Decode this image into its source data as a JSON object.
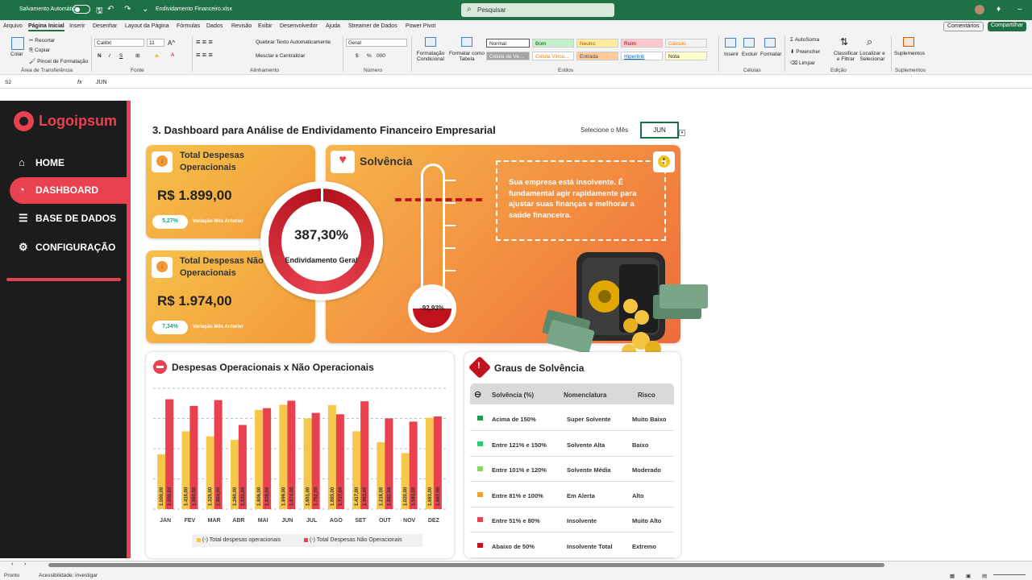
{
  "titlebar": {
    "autosave": "Salvamento Automático",
    "filename": "Endividamento Financeiro.xlsx",
    "search_placeholder": "Pesquisar"
  },
  "menu": [
    "Arquivo",
    "Página Inicial",
    "Inserir",
    "Desenhar",
    "Layout da Página",
    "Fórmulas",
    "Dados",
    "Revisão",
    "Exibir",
    "Desenvolvedor",
    "Ajuda",
    "Streamer de Dados",
    "Power Pivot"
  ],
  "menu_right": {
    "comments": "Comentários",
    "share": "Compartilhar"
  },
  "ribbon": {
    "clipboard": {
      "paste": "Colar",
      "cut": "Recortar",
      "copy": "Copiar",
      "painter": "Pincel de Formatação",
      "label": "Área de Transferência"
    },
    "font": {
      "name": "Calibri",
      "size": "11",
      "bold": "N",
      "italic": "I",
      "underline": "S",
      "label": "Fonte"
    },
    "alignment": {
      "wrap": "Quebrar Texto Automaticamente",
      "merge": "Mesclar e Centralizar",
      "label": "Alinhamento"
    },
    "number": {
      "format": "Geral",
      "percent": "%",
      "thousands": "000",
      "label": "Número"
    },
    "styles": {
      "cond": "Formatação Condicional",
      "table": "Formatar como Tabela",
      "items": [
        "Normal",
        "Bom",
        "Neutro",
        "Ruim",
        "Cálculo",
        "Célula de Ve...",
        "Célula Vincu...",
        "Entrada",
        "Hiperlink",
        "Nota"
      ],
      "label": "Estilos"
    },
    "cells": {
      "insert": "Inserir",
      "delete": "Excluir",
      "format": "Formatar",
      "label": "Células"
    },
    "editing": {
      "autosum": "AutoSoma",
      "fill": "Preencher",
      "clear": "Limpar",
      "sort": "Classificar e Filtrar",
      "find": "Localizar e Selecionar",
      "label": "Edição"
    },
    "addins": {
      "addins": "Suplementos",
      "label": "Suplementos"
    }
  },
  "formula": {
    "cell": "S2",
    "fx": "fx",
    "value": "JUN"
  },
  "sidebar": {
    "logo": "Logoipsum",
    "items": [
      "HOME",
      "DASHBOARD",
      "BASE DE DADOS",
      "CONFIGURAÇÃO"
    ]
  },
  "dashboard": {
    "title": "3. Dashboard para Análise de Endividamento Financeiro Empresarial",
    "select_label": "Selecione o Mês",
    "month": "JUN",
    "op": {
      "title": "Total Despesas Operacionais",
      "value": "R$ 1.899,00",
      "var": "5,27%",
      "var_label": "Variação Mês Anterior"
    },
    "nop": {
      "title": "Total Despesas Não Operacionais",
      "value": "R$ 1.974,00",
      "var": "7,34%",
      "var_label": "Variação Mês Anterior"
    },
    "debt": {
      "value": "387,30%",
      "label": "Endividamento Geral"
    },
    "solvency": {
      "title": "Solvência",
      "message": "Sua empresa está insolvente. É fundamental agir rapidamente para ajustar suas finanças e melhorar a saúde financeira.",
      "thermo": "-92,93%"
    },
    "chart_title": "Despesas Operacionais x Não Operacionais",
    "grades": {
      "title": "Graus de Solvência",
      "headers": [
        "Solvência (%)",
        "Nomenclatura",
        "Risco"
      ],
      "rows": [
        {
          "range": "Acima de 150%",
          "name": "Super Solvente",
          "risk": "Muito Baixo",
          "color": "#1e9e4a"
        },
        {
          "range": "Entre 121% e 150%",
          "name": "Solvente Alta",
          "risk": "Baixo",
          "color": "#2ecc71"
        },
        {
          "range": "Entre 101% e 120%",
          "name": "Solvente Média",
          "risk": "Moderado",
          "color": "#8bd65a"
        },
        {
          "range": "Entre 81% e 100%",
          "name": "Em Alerta",
          "risk": "Alto",
          "color": "#f0a030"
        },
        {
          "range": "Entre 51% e 80%",
          "name": "Insolvente",
          "risk": "Muito Alto",
          "color": "#e8414f"
        },
        {
          "range": "Abaixo  de 50%",
          "name": "Insolvente Total",
          "risk": "Extremo",
          "color": "#c0131d"
        }
      ]
    }
  },
  "chart_data": {
    "type": "bar",
    "categories": [
      "JAN",
      "FEV",
      "MAR",
      "ABR",
      "MAI",
      "JUN",
      "JUL",
      "AGO",
      "SET",
      "OUT",
      "NOV",
      "DEZ"
    ],
    "series": [
      {
        "name": "(-) Total despesas operacionais",
        "color": "#f5c74a",
        "values": [
          1000,
          1416,
          1325,
          1260,
          1806,
          1899,
          1651,
          1893,
          1417,
          1218,
          1020,
          1663
        ]
      },
      {
        "name": "(-) Total Despesas Não Operacionais",
        "color": "#e8414f",
        "values": [
          2000,
          1880,
          1984,
          1532,
          1839,
          1974,
          1752,
          1727,
          1963,
          1652,
          1593,
          1687
        ]
      }
    ],
    "data_labels": [
      [
        "1.000,00",
        "1.416,00",
        "1.325,00",
        "1.260,00",
        "1.806,00",
        "1.899,00",
        "1.651,00",
        "1.893,00",
        "1.417,00",
        "1.218,00",
        "1.020,00",
        "1.663,00"
      ],
      [
        "2.000,00",
        "1.880,00",
        "1.984,00",
        "1.532,00",
        "1.839,00",
        "1.974,00",
        "1.752,00",
        "1.727,00",
        "1.963,00",
        "1.652,00",
        "1.593,00",
        "1.687,00"
      ]
    ],
    "ylim": [
      0,
      2200
    ],
    "grid": true,
    "legend": "bottom"
  },
  "status": {
    "ready": "Pronto",
    "accessibility": "Acessibilidade: investigar"
  }
}
